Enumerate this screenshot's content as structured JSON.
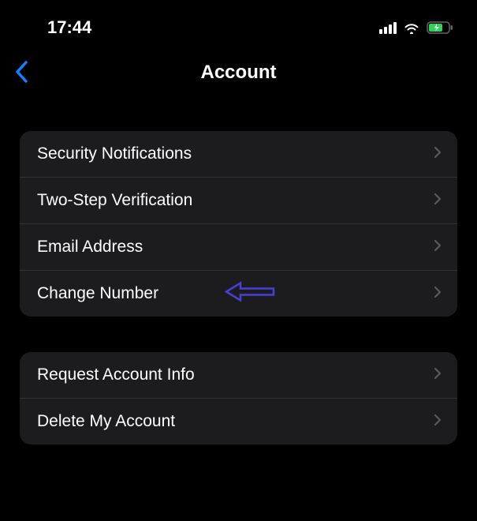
{
  "statusBar": {
    "time": "17:44"
  },
  "header": {
    "title": "Account"
  },
  "groups": [
    {
      "items": [
        {
          "label": "Security Notifications"
        },
        {
          "label": "Two-Step Verification"
        },
        {
          "label": "Email Address"
        },
        {
          "label": "Change Number",
          "highlighted": true
        }
      ]
    },
    {
      "items": [
        {
          "label": "Request Account Info"
        },
        {
          "label": "Delete My Account"
        }
      ]
    }
  ],
  "colors": {
    "accent": "#0a84ff",
    "annotation": "#4b3fd6",
    "batteryCharging": "#33d158"
  }
}
